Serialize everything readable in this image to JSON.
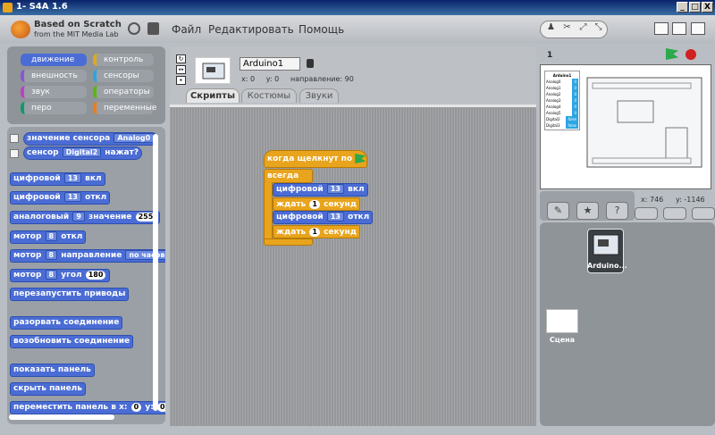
{
  "window": {
    "title": "1- S4A 1.6",
    "min": "_",
    "max": "□",
    "close": "X"
  },
  "logo": {
    "line1": "Based on Scratch",
    "line2": "from the MIT Media Lab"
  },
  "menu": {
    "file": "Файл",
    "edit": "Редактировать",
    "help": "Помощь"
  },
  "categories": [
    {
      "label": "движение",
      "color": "#4a6cd4"
    },
    {
      "label": "контроль",
      "color": "#e1a91a"
    },
    {
      "label": "внешность",
      "color": "#8a55d7"
    },
    {
      "label": "сенсоры",
      "color": "#2ca5e2"
    },
    {
      "label": "звук",
      "color": "#bb42c3"
    },
    {
      "label": "операторы",
      "color": "#5cb712"
    },
    {
      "label": "перо",
      "color": "#0e9a6c"
    },
    {
      "label": "переменные",
      "color": "#ee7d16"
    }
  ],
  "palette": {
    "sensor_value": "значение сенсора",
    "sensor_value_port": "Analog0",
    "sensor": "сенсор",
    "sensor_port": "Digital2",
    "pressed": "нажат?",
    "digital": "цифровой",
    "pin13": "13",
    "on": "вкл",
    "off": "откл",
    "analog": "аналоговый",
    "pin9": "9",
    "value": "значение",
    "val255": "255",
    "motor": "мотор",
    "motor8": "8",
    "motor_off": "откл",
    "direction": "направление",
    "clockwise": "по часово",
    "angle": "угол",
    "val180": "180",
    "restart": "перезапустить приводы",
    "disconnect": "разорвать соединение",
    "reconnect": "возобновить соединение",
    "show_panel": "показать панель",
    "hide_panel": "скрыть панель",
    "move_panel": "переместить панель в x:",
    "zero_x": "0",
    "y_label": "y:",
    "zero_y": "0"
  },
  "sprite": {
    "name": "Arduino1",
    "x": "x: 0",
    "y": "y: 0",
    "direction": "направление: 90"
  },
  "tabs": {
    "scripts": "Скрипты",
    "costumes": "Костюмы",
    "sounds": "Звуки"
  },
  "script": {
    "hat": "когда щелкнут по",
    "forever": "всегда",
    "digital": "цифровой",
    "pin": "13",
    "on": "вкл",
    "off": "откл",
    "wait": "ждать",
    "one": "1",
    "seconds": "секунд"
  },
  "stage": {
    "number": "1",
    "mouse_x": "x: 746",
    "mouse_y": "y: -1146",
    "readout_labels": [
      "Arduino1",
      "Analog0",
      "Analog1",
      "Analog2",
      "Analog3",
      "Analog4",
      "Analog5",
      "Digital2",
      "Digital3"
    ],
    "readout_values": [
      "0",
      "0",
      "0",
      "0",
      "0",
      "0",
      "false",
      "false"
    ]
  },
  "sprites": {
    "sprite_name": "Arduino...",
    "scene": "Сцена"
  },
  "icons": {
    "paint": "✎",
    "import": "★",
    "surprise": "?"
  }
}
